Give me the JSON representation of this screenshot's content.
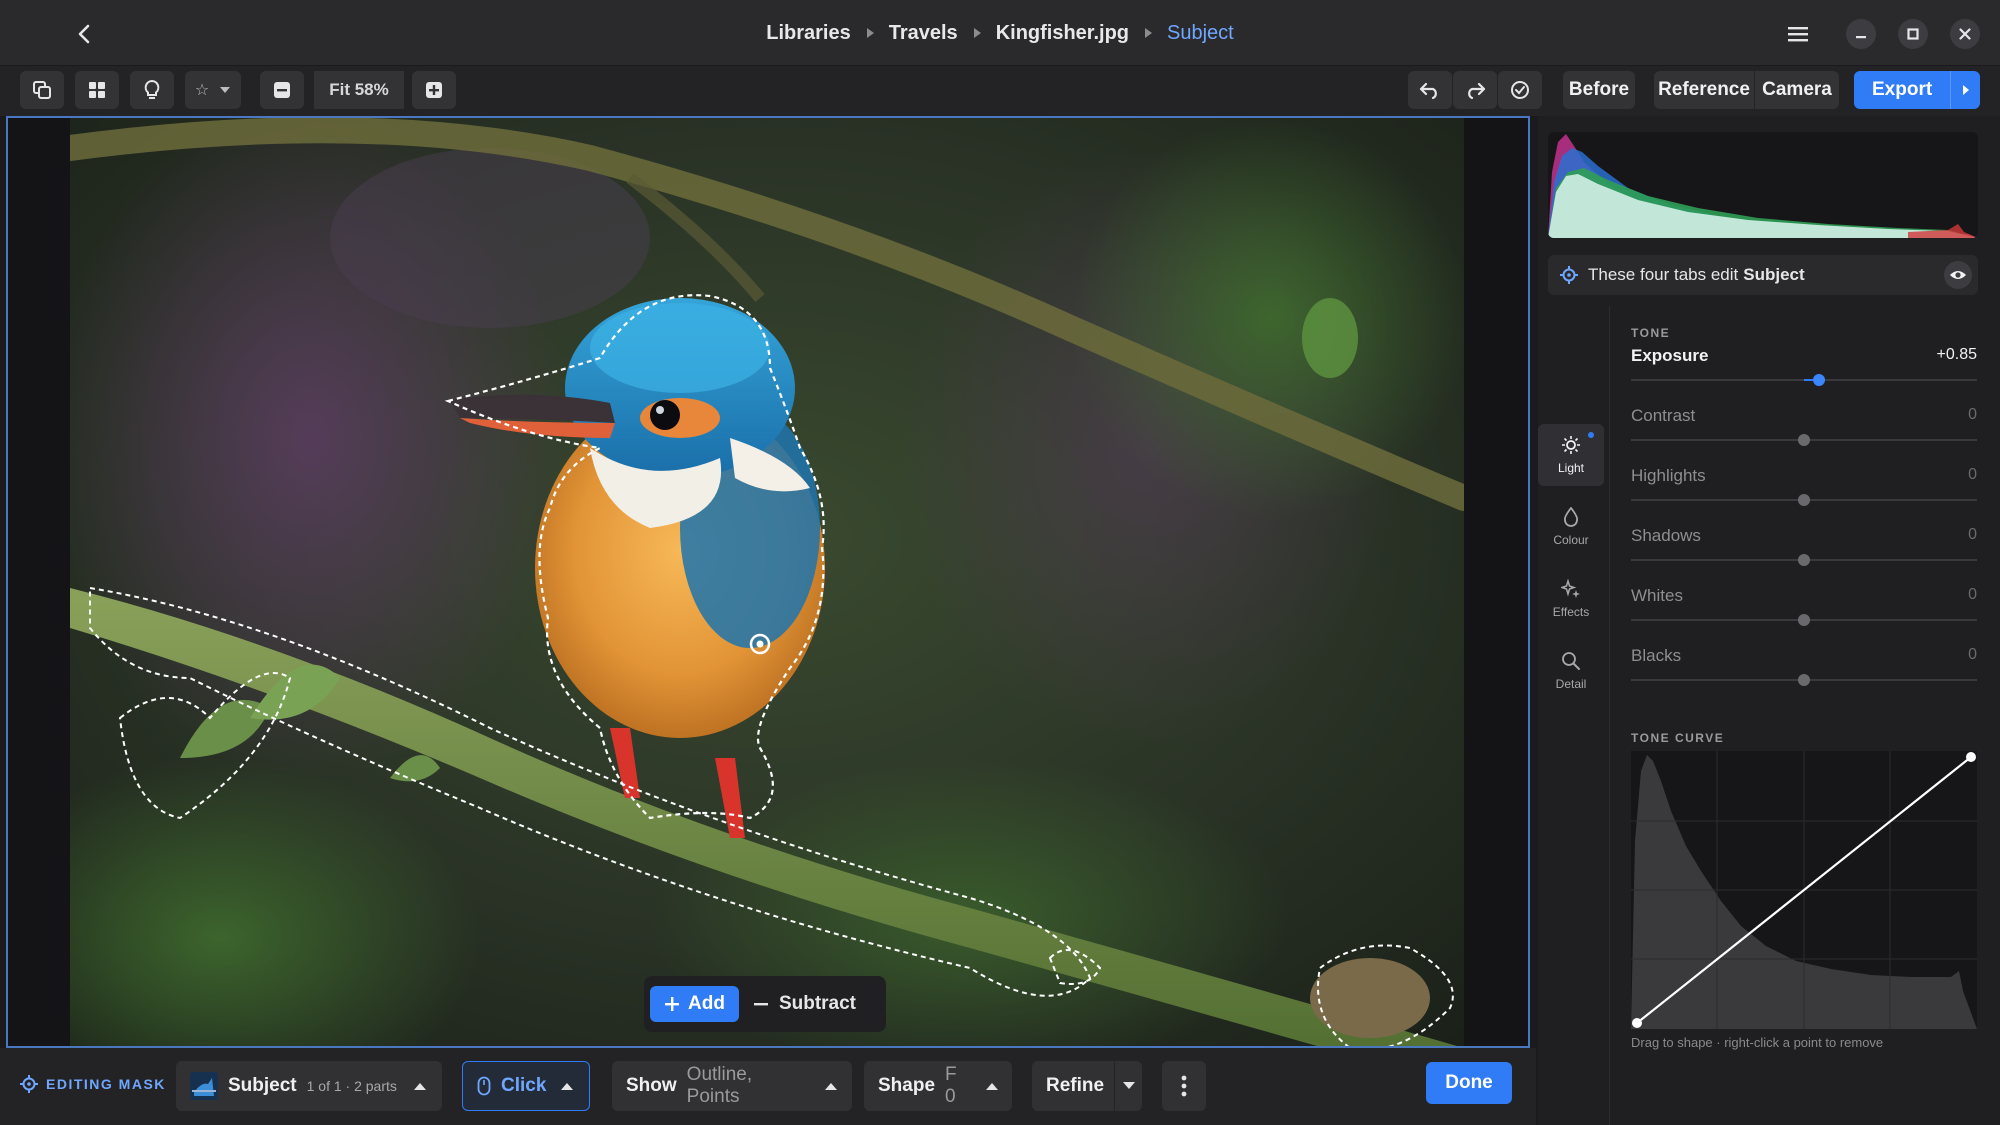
{
  "breadcrumb": {
    "items": [
      "Libraries",
      "Travels",
      "Kingfisher.jpg"
    ],
    "current": "Subject"
  },
  "toolbar": {
    "zoom_label": "Fit 58%",
    "before_label": "Before",
    "reference_label": "Reference",
    "camera_label": "Camera",
    "export_label": "Export",
    "rating_star": "☆"
  },
  "canvas": {
    "add_label": "Add",
    "subtract_label": "Subtract"
  },
  "panel": {
    "mask_note_prefix": "These four tabs edit",
    "mask_note_target": "Subject",
    "tabs": [
      {
        "label": "Light",
        "icon": "sun-icon",
        "active": true
      },
      {
        "label": "Colour",
        "icon": "drop-icon",
        "active": false
      },
      {
        "label": "Effects",
        "icon": "sparkle-icon",
        "active": false
      },
      {
        "label": "Detail",
        "icon": "magnifier-icon",
        "active": false
      }
    ],
    "tone_label": "TONE",
    "sliders": [
      {
        "name": "Exposure",
        "value": "+0.85",
        "level": 0.085
      },
      {
        "name": "Contrast",
        "value": "0",
        "level": 0
      },
      {
        "name": "Highlights",
        "value": "0",
        "level": 0
      },
      {
        "name": "Shadows",
        "value": "0",
        "level": 0
      },
      {
        "name": "Whites",
        "value": "0",
        "level": 0
      },
      {
        "name": "Blacks",
        "value": "0",
        "level": 0
      }
    ],
    "tone_curve_label": "TONE CURVE",
    "curve_hint": "Drag to shape · right-click a point to remove"
  },
  "bottom": {
    "editing_mask_label": "EDITING MASK",
    "subject_label": "Subject",
    "subject_parts": "1 of 1 · 2 parts",
    "click_label": "Click",
    "show_label": "Show",
    "show_value": "Outline, Points",
    "shape_label": "Shape",
    "shape_value": "F 0",
    "refine_label": "Refine",
    "done_label": "Done"
  },
  "colors": {
    "accent": "#2f7cf6",
    "accent_text": "#6fa7ff",
    "mask_outline": "#ffffff"
  }
}
